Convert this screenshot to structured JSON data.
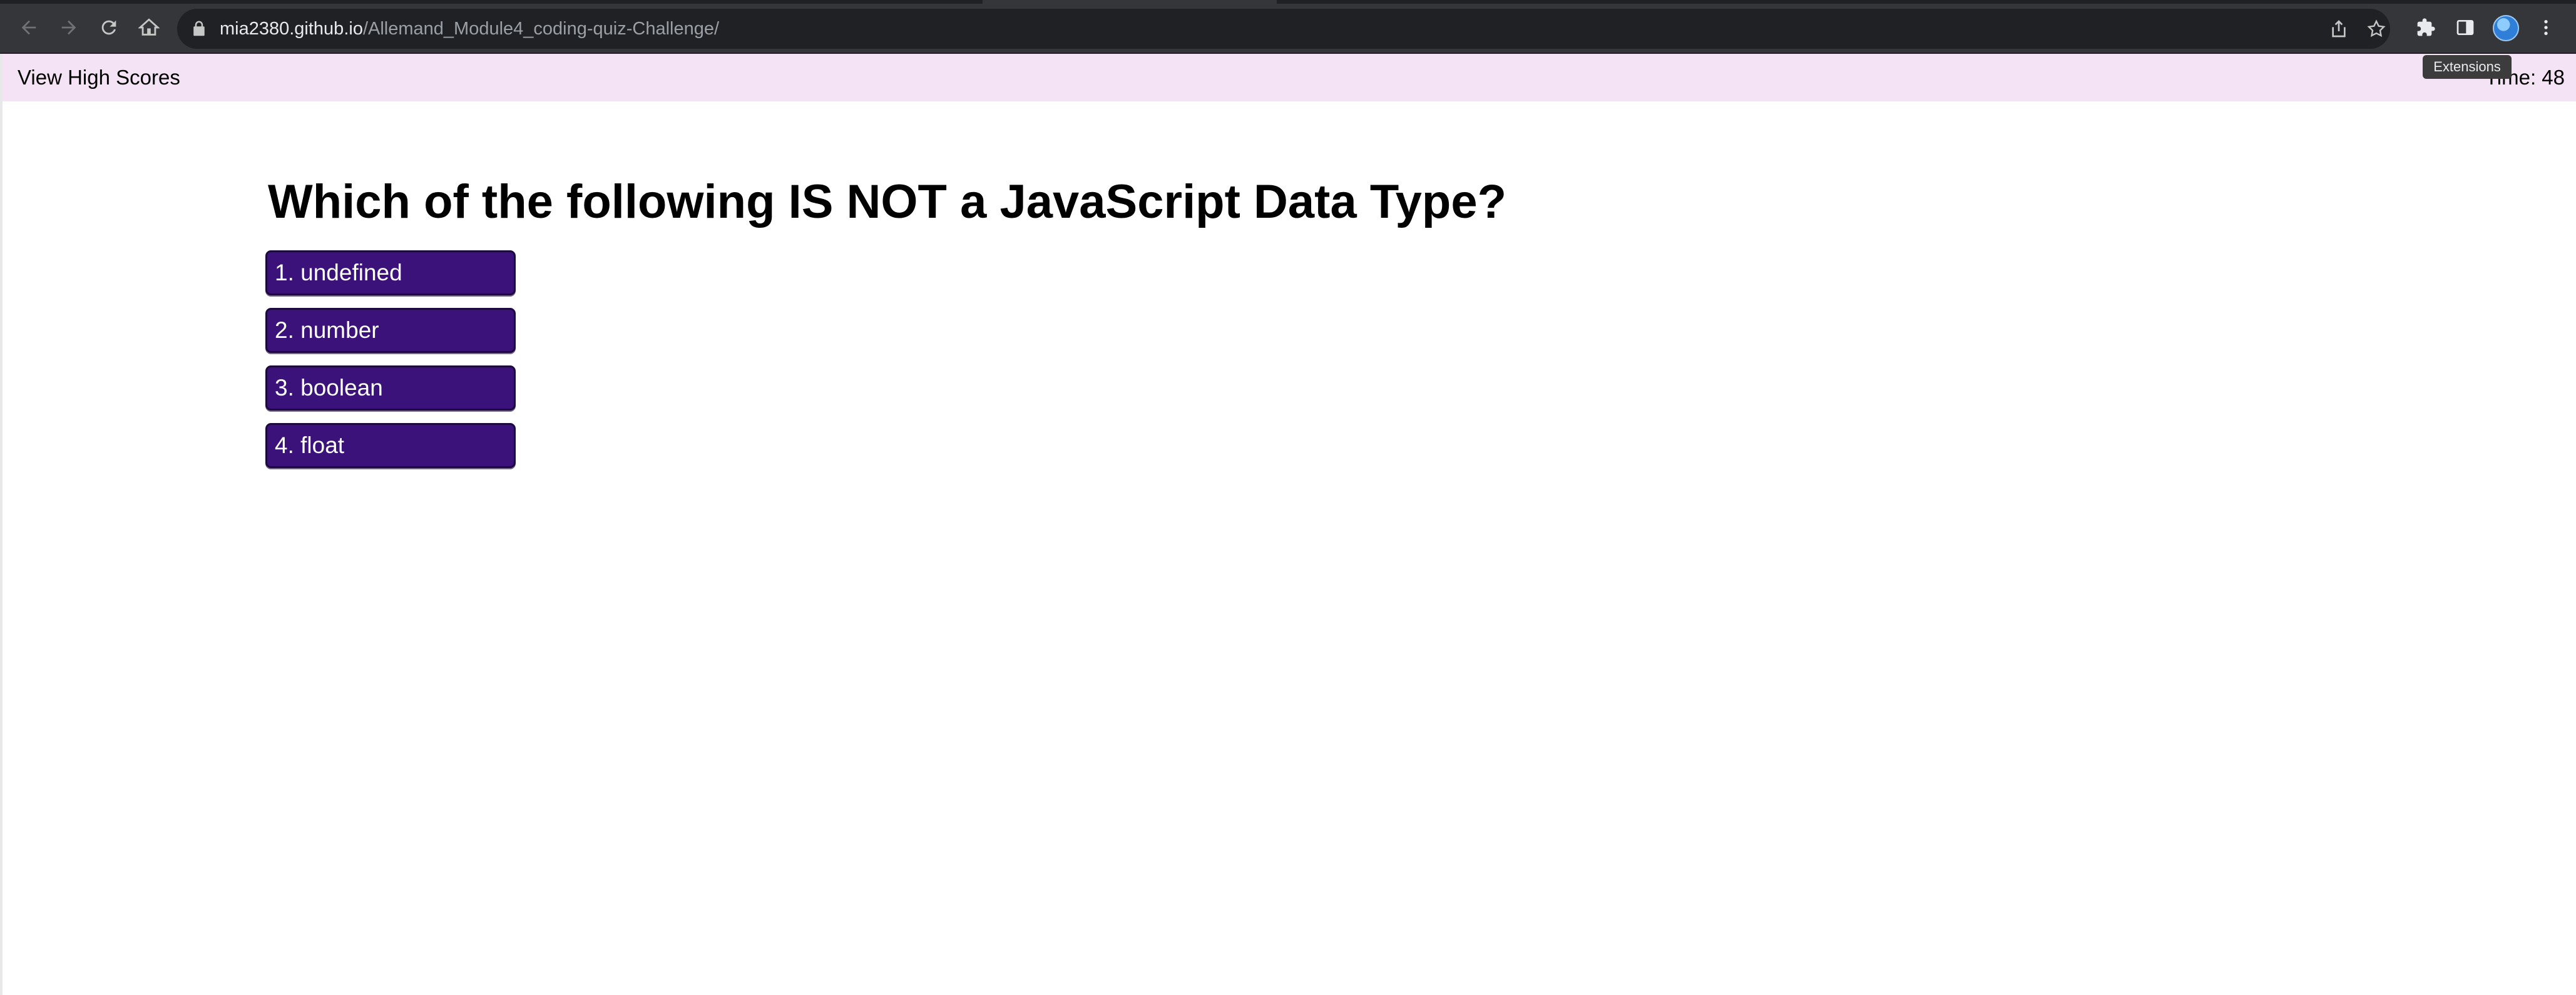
{
  "browser": {
    "url_host": "mia2380.github.io",
    "url_path": "/Allemand_Module4_coding-quiz-Challenge/",
    "tooltip": "Extensions"
  },
  "header": {
    "high_scores_label": "View High Scores",
    "timer_text": "Time: 48"
  },
  "quiz": {
    "question": "Which of the following IS NOT a JavaScript Data Type?",
    "choices": [
      {
        "label": "1. undefined"
      },
      {
        "label": "2. number"
      },
      {
        "label": "3. boolean"
      },
      {
        "label": "4. float"
      }
    ]
  },
  "colors": {
    "header_bg": "#f4e3f4",
    "button_bg": "#3b1279",
    "toolbar_bg": "#35363a"
  }
}
